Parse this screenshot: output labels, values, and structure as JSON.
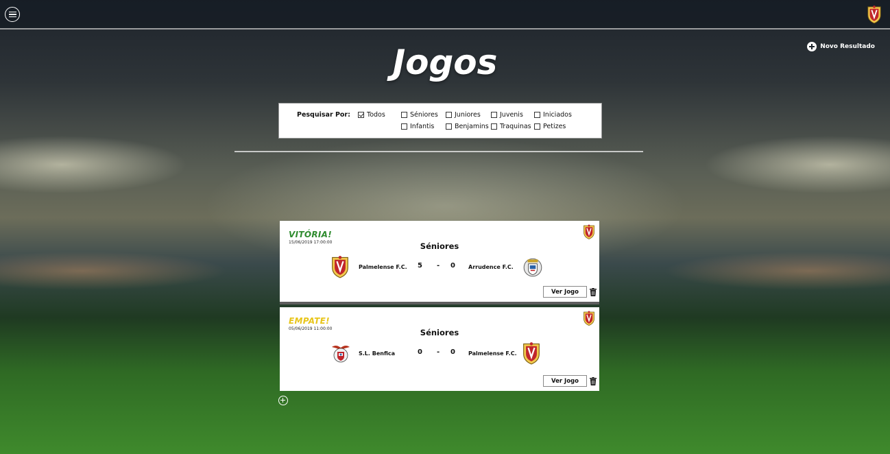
{
  "header": {
    "menu_icon": "hamburger-menu-icon",
    "logo_icon": "palmelense-crest-icon"
  },
  "toolbar": {
    "new_result_label": "Novo Resultado",
    "new_result_icon": "plus-circle-icon"
  },
  "page": {
    "title": "Jogos"
  },
  "filter": {
    "label": "Pesquisar Por:",
    "options": [
      {
        "label": "Todos",
        "checked": true
      },
      {
        "label": "Séniores",
        "checked": false
      },
      {
        "label": "Juniores",
        "checked": false
      },
      {
        "label": "Juvenis",
        "checked": false
      },
      {
        "label": "Iniciados",
        "checked": false
      },
      {
        "label": "Infantis",
        "checked": false
      },
      {
        "label": "Benjamins",
        "checked": false
      },
      {
        "label": "Traquinas",
        "checked": false
      },
      {
        "label": "Petizes",
        "checked": false
      }
    ]
  },
  "games": [
    {
      "result": "VITÓRIA!",
      "result_color": "#2e8b2e",
      "date": "15/06/2019 17:00:00",
      "category": "Séniores",
      "home_team": "Palmelense F.C.",
      "home_crest": "palmelense-crest-icon",
      "home_score": "5",
      "separator": "-",
      "away_score": "0",
      "away_team": "Arrudence F.C.",
      "away_crest": "arruda-crest-icon",
      "view_label": "Ver Jogo",
      "delete_icon": "trash-icon"
    },
    {
      "result": "EMPATE!",
      "result_color": "#e8c51a",
      "date": "05/06/2019 11:00:00",
      "category": "Séniores",
      "home_team": "S.L. Benfica",
      "home_crest": "benfica-crest-icon",
      "home_score": "0",
      "separator": "-",
      "away_score": "0",
      "away_team": "Palmelense F.C.",
      "away_crest": "palmelense-crest-icon",
      "view_label": "Ver Jogo",
      "delete_icon": "trash-icon"
    }
  ],
  "footer": {
    "add_icon": "plus-circle-icon"
  }
}
